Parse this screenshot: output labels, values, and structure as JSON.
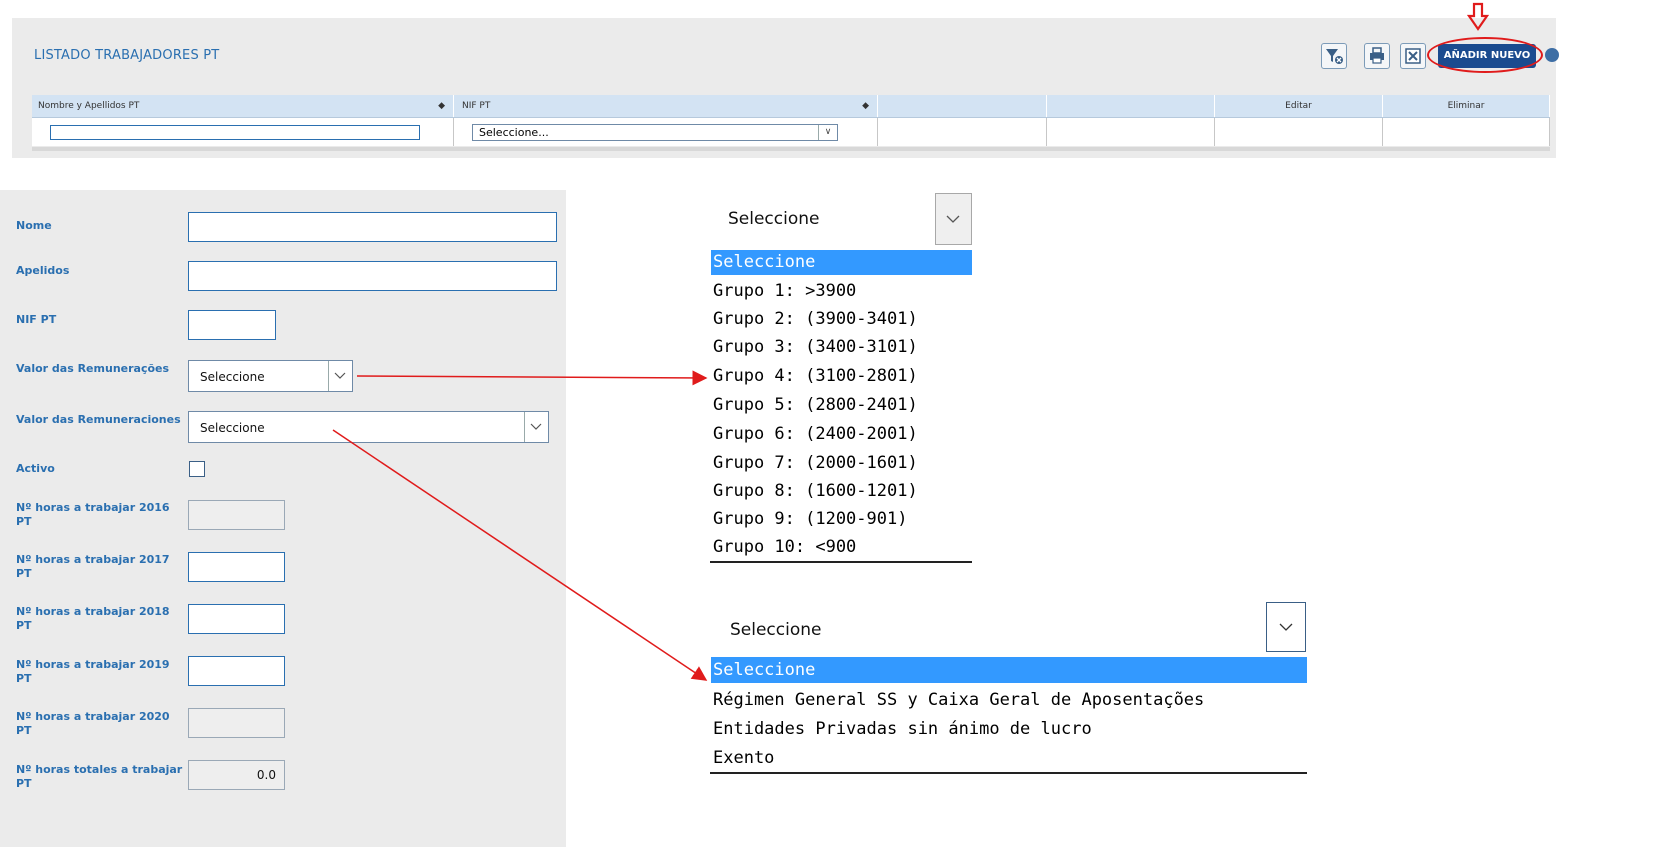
{
  "listing": {
    "title": "LISTADO TRABAJADORES PT",
    "add_button": "AÑADIR NUEVO",
    "columns": [
      "Nombre y Apellidos PT",
      "NIF PT",
      "",
      "",
      "Editar",
      "Eliminar"
    ],
    "filter_select": "Seleccione..."
  },
  "form": {
    "labels": {
      "nome": "Nome",
      "apelidos": "Apelidos",
      "nif": "NIF PT",
      "remuneracoes": "Valor das Remunerações",
      "remuneraciones": "Valor das Remuneraciones",
      "activo": "Activo",
      "h2016": "Nº horas a trabajar 2016 PT",
      "h2017": "Nº horas a trabajar 2017 PT",
      "h2018": "Nº horas a trabajar 2018 PT",
      "h2019": "Nº horas a trabajar 2019 PT",
      "h2020": "Nº horas a trabajar 2020 PT",
      "htotal": "Nº horas totales a trabajar PT"
    },
    "select_remuneracoes": "Seleccione",
    "select_remuneraciones": "Seleccione",
    "total_hours": "0.0"
  },
  "dropdown1": {
    "selected": "Seleccione",
    "options": [
      "Seleccione",
      "Grupo 1: >3900",
      "Grupo 2: (3900-3401)",
      "Grupo 3: (3400-3101)",
      "Grupo 4: (3100-2801)",
      "Grupo 5: (2800-2401)",
      "Grupo 6: (2400-2001)",
      "Grupo 7: (2000-1601)",
      "Grupo 8: (1600-1201)",
      "Grupo 9: (1200-901)",
      "Grupo 10: <900"
    ]
  },
  "dropdown2": {
    "selected": "Seleccione",
    "options": [
      "Seleccione",
      "Régimen General SS y Caixa Geral de Aposentações",
      "Entidades Privadas sin ánimo de lucro",
      "Exento"
    ]
  },
  "colors": {
    "accent": "#2a6fb0",
    "button": "#1b4b8f",
    "highlight": "#3399ff",
    "annotation": "#e01b1b"
  }
}
